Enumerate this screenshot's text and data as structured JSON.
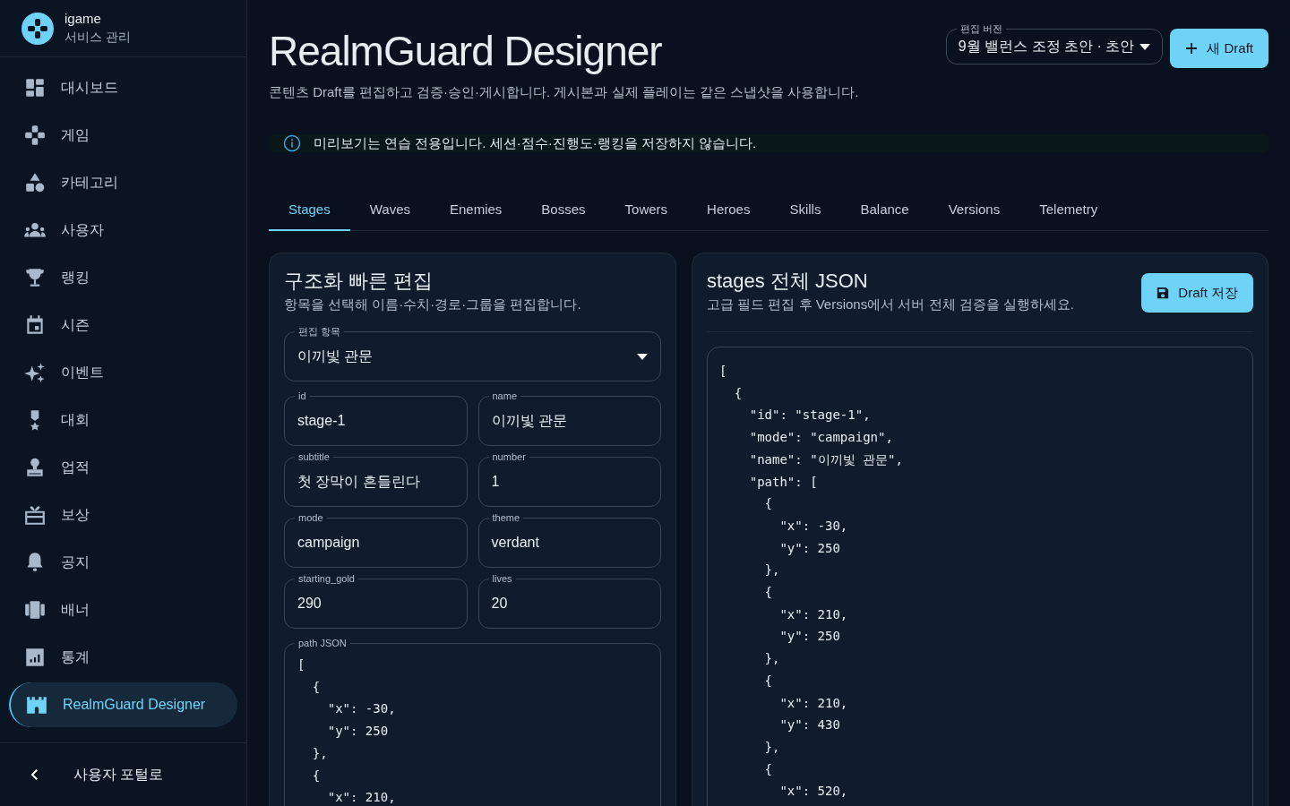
{
  "sidebar": {
    "brand": {
      "name": "igame",
      "subtitle": "서비스 관리"
    },
    "items": [
      {
        "label": "대시보드",
        "selected": false
      },
      {
        "label": "게임",
        "selected": false
      },
      {
        "label": "카테고리",
        "selected": false
      },
      {
        "label": "사용자",
        "selected": false
      },
      {
        "label": "랭킹",
        "selected": false
      },
      {
        "label": "시즌",
        "selected": false
      },
      {
        "label": "이벤트",
        "selected": false
      },
      {
        "label": "대회",
        "selected": false
      },
      {
        "label": "업적",
        "selected": false
      },
      {
        "label": "보상",
        "selected": false
      },
      {
        "label": "공지",
        "selected": false
      },
      {
        "label": "배너",
        "selected": false
      },
      {
        "label": "통계",
        "selected": false
      },
      {
        "label": "RealmGuard Designer",
        "selected": true
      }
    ],
    "footer_link": "사용자 포털로"
  },
  "header": {
    "title": "RealmGuard Designer",
    "description": "콘텐츠 Draft를 편집하고 검증·승인·게시합니다. 게시본과 실제 플레이는 같은 스냅샷을 사용합니다.",
    "version_select": {
      "label": "편집 버전",
      "value": "9월 밸런스 조정 초안 · 초안"
    },
    "new_button": "새 Draft"
  },
  "alert": "미리보기는 연습 전용입니다. 세션·점수·진행도·랭킹을 저장하지 않습니다.",
  "tabs": [
    {
      "label": "Stages",
      "selected": true
    },
    {
      "label": "Waves",
      "selected": false
    },
    {
      "label": "Enemies",
      "selected": false
    },
    {
      "label": "Bosses",
      "selected": false
    },
    {
      "label": "Towers",
      "selected": false
    },
    {
      "label": "Heroes",
      "selected": false
    },
    {
      "label": "Skills",
      "selected": false
    },
    {
      "label": "Balance",
      "selected": false
    },
    {
      "label": "Versions",
      "selected": false
    },
    {
      "label": "Telemetry",
      "selected": false
    }
  ],
  "quick_edit": {
    "title": "구조화 빠른 편집",
    "description": "항목을 선택해 이름·수치·경로·그룹을 편집합니다.",
    "item_select": {
      "label": "편집 항목",
      "value": "이끼빛 관문"
    },
    "fields": [
      {
        "label": "id",
        "value": "stage-1"
      },
      {
        "label": "name",
        "value": "이끼빛 관문"
      },
      {
        "label": "subtitle",
        "value": "첫 장막이 흔들린다"
      },
      {
        "label": "number",
        "value": "1"
      },
      {
        "label": "mode",
        "value": "campaign"
      },
      {
        "label": "theme",
        "value": "verdant"
      },
      {
        "label": "starting_gold",
        "value": "290"
      },
      {
        "label": "lives",
        "value": "20"
      }
    ],
    "path_json": {
      "label": "path JSON",
      "lines": [
        "[",
        "  {",
        "    \"x\": -30,",
        "    \"y\": 250",
        "  },",
        "  {",
        "    \"x\": 210,"
      ]
    }
  },
  "full_json": {
    "title": "stages 전체 JSON",
    "description": "고급 필드 편집 후 Versions에서 서버 전체 검증을 실행하세요.",
    "save_button": "Draft 저장",
    "lines": [
      "[",
      "  {",
      "    \"id\": \"stage-1\",",
      "    \"mode\": \"campaign\",",
      "    \"name\": \"이끼빛 관문\",",
      "    \"path\": [",
      "      {",
      "        \"x\": -30,",
      "        \"y\": 250",
      "      },",
      "      {",
      "        \"x\": 210,",
      "        \"y\": 250",
      "      },",
      "      {",
      "        \"x\": 210,",
      "        \"y\": 430",
      "      },",
      "      {",
      "        \"x\": 520,"
    ]
  }
}
